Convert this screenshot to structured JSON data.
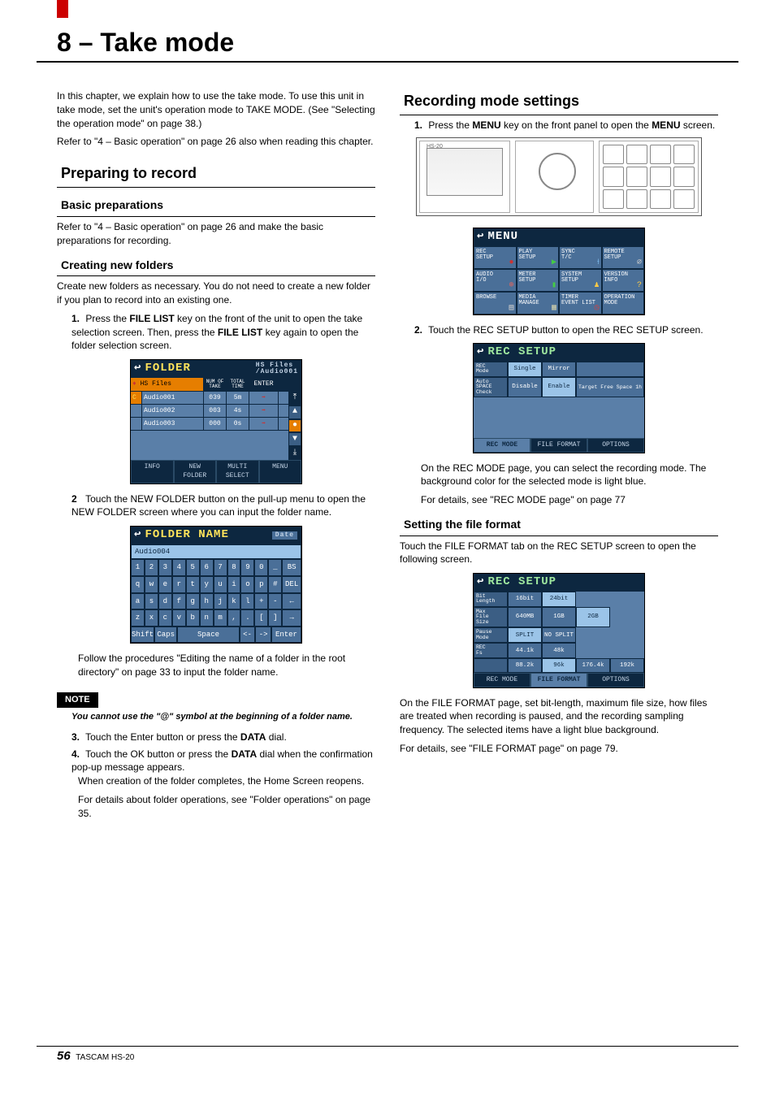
{
  "chapter_title": "8 – Take mode",
  "intro_p1": "In this chapter, we explain how to use the take mode. To use this unit in take mode, set the unit's operation mode to TAKE MODE. (See \"Selecting the operation mode\" on page 38.)",
  "intro_p2": "Refer to \"4 – Basic operation\" on page 26 also when reading this chapter.",
  "h2_prep": "Preparing to record",
  "h3_basic": "Basic preparations",
  "basic_p": "Refer to \"4 – Basic operation\" on page 26 and make the basic preparations for recording.",
  "h3_folders": "Creating new folders",
  "folders_p": "Create new folders as necessary. You do not need to create a new folder if you plan to record into an existing one.",
  "step1_a": "Press the ",
  "step1_b": "FILE LIST",
  "step1_c": " key on the front of the unit to open the take selection screen. Then, press the ",
  "step1_d": "FILE LIST",
  "step1_e": " key again to open the folder selection screen.",
  "folder_screen": {
    "title": "FOLDER",
    "sub1": "HS Files",
    "sub2": "/Audio001",
    "hdr_name": "HS Files",
    "hdr_take": "NUM OF TAKE",
    "hdr_time": "TOTAL TIME",
    "hdr_enter": "ENTER",
    "rows": [
      {
        "name": "Audio001",
        "n": "039",
        "t": "5m",
        "cur": true
      },
      {
        "name": "Audio002",
        "n": "003",
        "t": "4s",
        "cur": false
      },
      {
        "name": "Audio003",
        "n": "000",
        "t": "0s",
        "cur": false
      }
    ],
    "btm": [
      "INFO",
      "NEW FOLDER",
      "MULTI SELECT",
      "MENU"
    ]
  },
  "step2": "Touch the NEW FOLDER button on the pull-up menu to open the NEW FOLDER screen where you can input the folder name.",
  "keyboard_screen": {
    "title": "FOLDER NAME",
    "date": "Date",
    "value": "Audio004",
    "rows": [
      [
        "1",
        "2",
        "3",
        "4",
        "5",
        "6",
        "7",
        "8",
        "9",
        "0",
        "_",
        "BS"
      ],
      [
        "q",
        "w",
        "e",
        "r",
        "t",
        "y",
        "u",
        "i",
        "o",
        "p",
        "#",
        "DEL"
      ],
      [
        "a",
        "s",
        "d",
        "f",
        "g",
        "h",
        "j",
        "k",
        "l",
        "+",
        "-",
        "←"
      ],
      [
        "z",
        "x",
        "c",
        "v",
        "b",
        "n",
        "m",
        ",",
        ".",
        "[",
        "]",
        "→"
      ]
    ],
    "bottom": [
      "Shift",
      "Caps",
      "Space",
      "<-",
      "->",
      "Enter"
    ]
  },
  "step2b": "Follow the procedures \"Editing the name of a folder in the root directory\" on page 33 to input the folder name.",
  "note_label": "NOTE",
  "note_body": "You cannot use the \"@\" symbol at the beginning of a folder name.",
  "step3_a": "Touch the Enter button or press the ",
  "step3_b": "DATA",
  "step3_c": " dial.",
  "step4_a": "Touch the OK button or press the ",
  "step4_b": "DATA",
  "step4_c": " dial when the confirmation pop-up message appears.",
  "step4_p2": "When creation of the folder completes, the Home Screen reopens.",
  "step4_p3": "For details about folder operations, see \"Folder operations\" on page 35.",
  "h2_rec": "Recording mode settings",
  "rec_step1_a": "Press the ",
  "rec_step1_b": "MENU",
  "rec_step1_c": " key on the front panel to open the ",
  "rec_step1_d": "MENU",
  "rec_step1_e": " screen.",
  "hw_label": "HS-20",
  "menu_screen": {
    "title": "MENU",
    "items": [
      {
        "l": "REC SETUP",
        "g": "●",
        "c": "#c33"
      },
      {
        "l": "PLAY SETUP",
        "g": "▶",
        "c": "#4c4"
      },
      {
        "l": "SYNC T/C",
        "g": "⟊",
        "c": "#8cf"
      },
      {
        "l": "REMOTE SETUP",
        "g": "⌀",
        "c": "#ccc"
      },
      {
        "l": "AUDIO I/O",
        "g": "⊛",
        "c": "#c66"
      },
      {
        "l": "METER SETUP",
        "g": "▮",
        "c": "#4c4"
      },
      {
        "l": "SYSTEM SETUP",
        "g": "♟",
        "c": "#fc4"
      },
      {
        "l": "VERSION INFO",
        "g": "?",
        "c": "#fc4"
      },
      {
        "l": "BROWSE",
        "g": "▤",
        "c": "#ccc"
      },
      {
        "l": "MEDIA MANAGE",
        "g": "▦",
        "c": "#cca"
      },
      {
        "l": "TIMER EVENT LIST",
        "g": "◷",
        "c": "#c44"
      },
      {
        "l": "OPERATION MODE",
        "g": "",
        "c": ""
      }
    ]
  },
  "rec_step2": "Touch the REC SETUP button to open the REC SETUP screen.",
  "recsetup1": {
    "title": "REC SETUP",
    "rows": [
      {
        "label": "REC Mode",
        "opts": [
          "Single",
          "Mirror"
        ],
        "sel": 0,
        "extra": ""
      },
      {
        "label": "Auto SPACE Check",
        "opts": [
          "Disable",
          "Enable"
        ],
        "sel": 1,
        "extra": "Target Free Space   1h"
      }
    ],
    "tabs": [
      "REC MODE",
      "FILE FORMAT",
      "OPTIONS"
    ],
    "tabs_sel": 0
  },
  "rec_p1": "On the REC MODE page, you can select the recording mode. The background color for the selected mode is light blue.",
  "rec_p2": "For details, see \"REC MODE page\" on page 77",
  "h3_ff": "Setting the file format",
  "ff_p": "Touch the FILE FORMAT tab on the REC SETUP screen to open the following screen.",
  "recsetup2": {
    "title": "REC SETUP",
    "rows": [
      {
        "label": "Bit Length",
        "opts": [
          "16bit",
          "24bit",
          "",
          ""
        ],
        "sel": 1
      },
      {
        "label": "Max File Size",
        "opts": [
          "640MB",
          "1GB",
          "2GB",
          ""
        ],
        "sel": 2
      },
      {
        "label": "Pause Mode",
        "opts": [
          "SPLIT",
          "NO SPLIT",
          "",
          ""
        ],
        "sel": 0
      },
      {
        "label": "REC Fs",
        "opts": [
          "44.1k",
          "48k",
          "",
          ""
        ],
        "sel": -1
      },
      {
        "label": "",
        "opts": [
          "88.2k",
          "96k",
          "176.4k",
          "192k"
        ],
        "sel": 1
      }
    ],
    "tabs": [
      "REC MODE",
      "FILE FORMAT",
      "OPTIONS"
    ],
    "tabs_sel": 1
  },
  "ff_p2": "On the FILE FORMAT page, set bit-length, maximum file size, how files are treated when recording is paused, and the recording sampling frequency. The selected items have a light blue background.",
  "ff_p3": "For details, see \"FILE FORMAT page\" on page 79.",
  "footer_page": "56",
  "footer_model": "TASCAM HS-20"
}
